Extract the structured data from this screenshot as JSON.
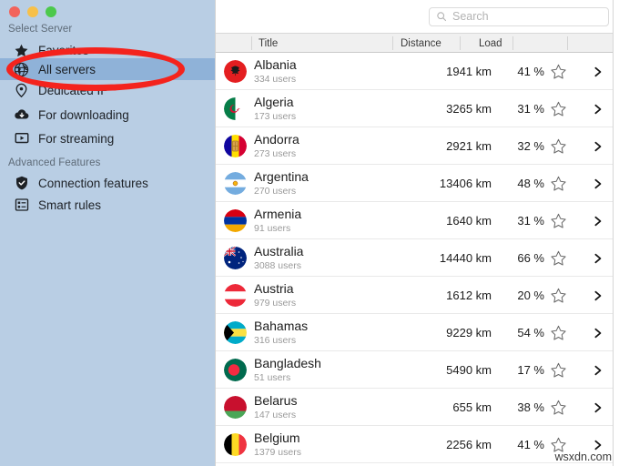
{
  "window": {
    "traffic_lights": [
      "close",
      "minimize",
      "zoom"
    ],
    "colors": {
      "close": "#f2635c",
      "minimize": "#f7c049",
      "zoom": "#4cc94c"
    }
  },
  "sidebar": {
    "background": "#b9cee4",
    "selected_background": "#8fb2d8",
    "sections": [
      {
        "title": "Select Server",
        "items": [
          {
            "label": "Favorites",
            "icon": "star-icon",
            "selected": false
          },
          {
            "label": "All servers",
            "icon": "globe-icon",
            "selected": true
          },
          {
            "label": "Dedicated IP",
            "icon": "pin-icon",
            "selected": false
          },
          {
            "label": "For downloading",
            "icon": "cloud-download-icon",
            "selected": false
          },
          {
            "label": "For streaming",
            "icon": "play-screen-icon",
            "selected": false
          }
        ]
      },
      {
        "title": "Advanced Features",
        "items": [
          {
            "label": "Connection features",
            "icon": "shield-check-icon",
            "selected": false
          },
          {
            "label": "Smart rules",
            "icon": "rules-list-icon",
            "selected": false
          }
        ]
      }
    ]
  },
  "annotation": {
    "shape": "ellipse",
    "color": "#f4231d",
    "target": "All servers"
  },
  "search": {
    "placeholder": "Search",
    "value": "",
    "icon": "search-icon"
  },
  "table": {
    "columns": [
      {
        "key": "title",
        "label": "Title"
      },
      {
        "key": "distance",
        "label": "Distance"
      },
      {
        "key": "load",
        "label": "Load"
      },
      {
        "key": "favorite",
        "label": ""
      },
      {
        "key": "disclosure",
        "label": ""
      }
    ],
    "rows": [
      {
        "title": "Albania",
        "users": "334 users",
        "distance": "1941 km",
        "load": "41 %",
        "flag": "flag-albania",
        "favorite": false
      },
      {
        "title": "Algeria",
        "users": "173 users",
        "distance": "3265 km",
        "load": "31 %",
        "flag": "flag-algeria",
        "favorite": false
      },
      {
        "title": "Andorra",
        "users": "273 users",
        "distance": "2921 km",
        "load": "32 %",
        "flag": "flag-andorra",
        "favorite": false
      },
      {
        "title": "Argentina",
        "users": "270 users",
        "distance": "13406 km",
        "load": "48 %",
        "flag": "flag-argentina",
        "favorite": false
      },
      {
        "title": "Armenia",
        "users": "91 users",
        "distance": "1640 km",
        "load": "31 %",
        "flag": "flag-armenia",
        "favorite": false
      },
      {
        "title": "Australia",
        "users": "3088 users",
        "distance": "14440 km",
        "load": "66 %",
        "flag": "flag-australia",
        "favorite": false
      },
      {
        "title": "Austria",
        "users": "979 users",
        "distance": "1612 km",
        "load": "20 %",
        "flag": "flag-austria",
        "favorite": false
      },
      {
        "title": "Bahamas",
        "users": "316 users",
        "distance": "9229 km",
        "load": "54 %",
        "flag": "flag-bahamas",
        "favorite": false
      },
      {
        "title": "Bangladesh",
        "users": "51 users",
        "distance": "5490 km",
        "load": "17 %",
        "flag": "flag-bangladesh",
        "favorite": false
      },
      {
        "title": "Belarus",
        "users": "147 users",
        "distance": "655 km",
        "load": "38 %",
        "flag": "flag-belarus",
        "favorite": false
      },
      {
        "title": "Belgium",
        "users": "1379 users",
        "distance": "2256 km",
        "load": "41 %",
        "flag": "flag-belgium",
        "favorite": false
      }
    ]
  },
  "watermark": {
    "text": "wsxdn.com"
  }
}
